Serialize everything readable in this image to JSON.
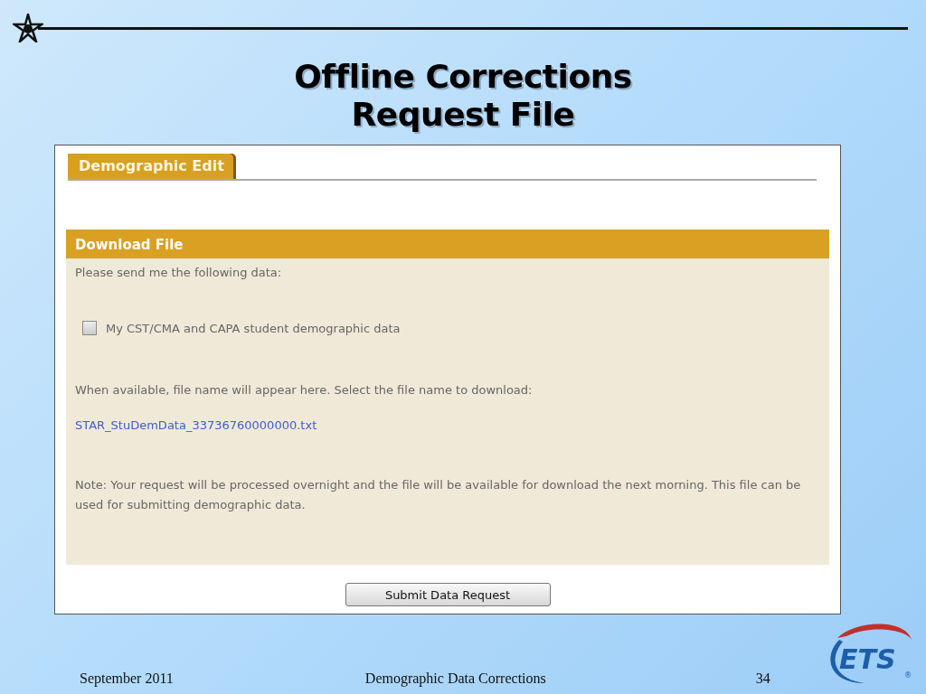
{
  "title": [
    "Offline Corrections",
    "Request File"
  ],
  "tabs": [
    {
      "label": "Demographic Edit",
      "selected": true
    }
  ],
  "panel": {
    "heading": "Download File",
    "intro": "Please send me the following data:",
    "options": [
      {
        "label": "My CST/CMA and CAPA student demographic data",
        "checked": false
      }
    ],
    "file_hint": "When available, file name will appear here. Select the file name to download:",
    "file_link": "STAR_StuDemData_33736760000000.txt",
    "note": "Note: Your request will be processed overnight and the file will be available for download the next morning. This file can be used for submitting demographic data."
  },
  "submit_button": "Submit Data Request",
  "footer": {
    "date": "September 2011",
    "topic": "Demographic Data Corrections",
    "page": "34"
  },
  "logo": {
    "text": "ETS",
    "mark": "®"
  }
}
